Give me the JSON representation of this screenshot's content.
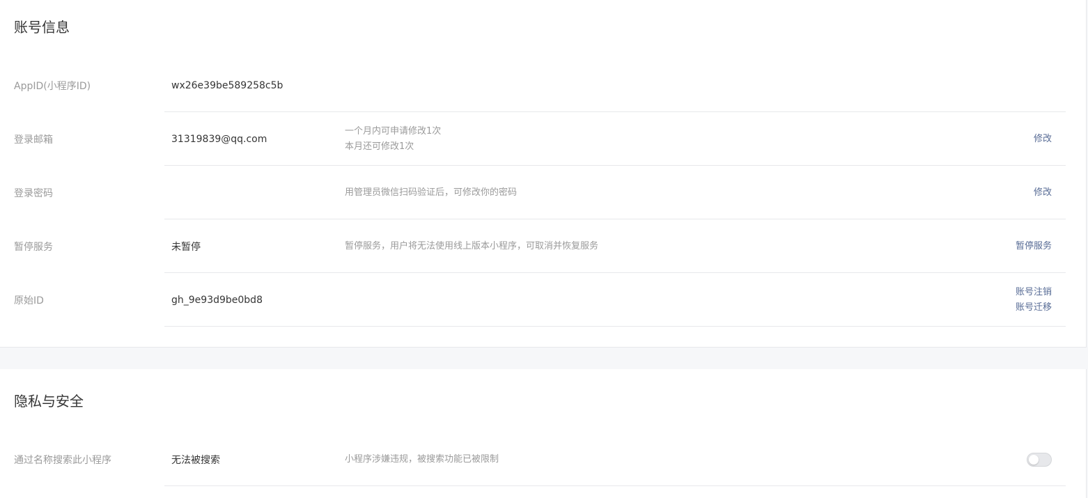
{
  "account": {
    "title": "账号信息",
    "rows": [
      {
        "label": "AppID(小程序ID)",
        "value": "wx26e39be589258c5b"
      },
      {
        "label": "登录邮箱",
        "value": "31319839@qq.com",
        "desc_lines": [
          "一个月内可申请修改1次",
          "本月还可修改1次"
        ],
        "actions": [
          "修改"
        ]
      },
      {
        "label": "登录密码",
        "desc_lines": [
          "用管理员微信扫码验证后，可修改你的密码"
        ],
        "actions": [
          "修改"
        ]
      },
      {
        "label": "暂停服务",
        "value": "未暂停",
        "desc_lines": [
          "暂停服务，用户将无法使用线上版本小程序，可取消并恢复服务"
        ],
        "actions": [
          "暂停服务"
        ]
      },
      {
        "label": "原始ID",
        "value": "gh_9e93d9be0bd8",
        "actions": [
          "账号注销",
          "账号迁移"
        ]
      }
    ]
  },
  "privacy": {
    "title": "隐私与安全",
    "rows": [
      {
        "label": "通过名称搜索此小程序",
        "value": "无法被搜索",
        "desc_lines": [
          "小程序涉嫌违规，被搜索功能已被限制"
        ],
        "toggle_on": false
      }
    ]
  },
  "colors": {
    "link": "#576b95",
    "label": "#9a9a9a",
    "text": "#353535",
    "divider": "#e7e8eb",
    "background": "#f6f7f9"
  }
}
